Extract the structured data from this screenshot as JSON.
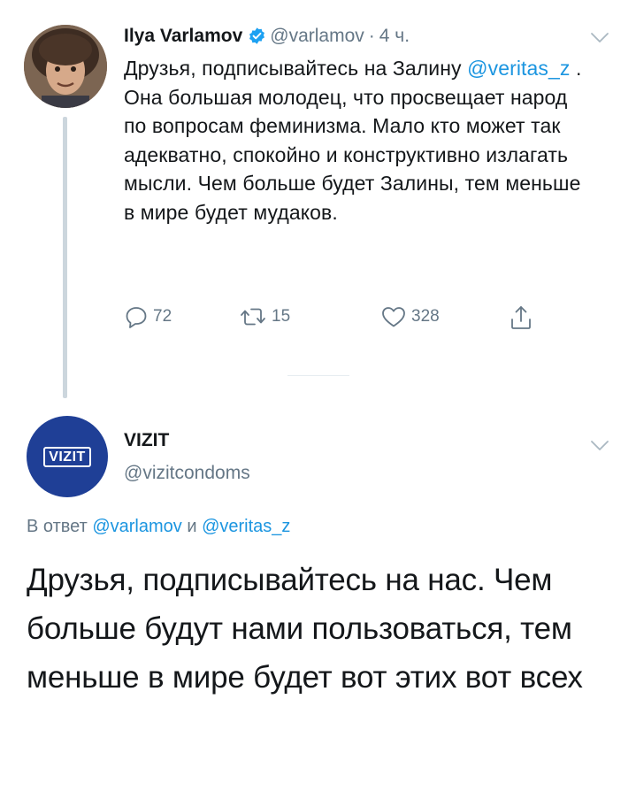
{
  "tweet1": {
    "author_name": "Ilya Varlamov",
    "author_handle": "@varlamov",
    "separator": "·",
    "time": "4 ч.",
    "text_before": "Друзья, подписывайтесь на Залину ",
    "mention": "@veritas_z",
    "text_after": " . Она большая молодец, что просвещает народ по вопросам феминизма. Мало кто может так адекватно, спокойно и конструктивно излагать мысли. Чем больше будет Залины, тем меньше в мире будет мудаков.",
    "reply_count": "72",
    "retweet_count": "15",
    "like_count": "328"
  },
  "tweet2": {
    "author_name": "VIZIT",
    "author_handle": "@vizitcondoms",
    "avatar_logo_text": "VIZIT",
    "reply_prefix": "В ответ ",
    "reply_user1": "@varlamov",
    "reply_joiner": " и ",
    "reply_user2": "@veritas_z",
    "text": "Друзья, подписывайтесь на нас. Чем больше будут нами пользоваться, тем меньше в мире будет вот этих вот всех"
  },
  "icons": {
    "verified": "verified-badge-icon",
    "caret": "chevron-down-icon",
    "reply": "reply-icon",
    "retweet": "retweet-icon",
    "like": "heart-icon",
    "share": "share-icon"
  },
  "colors": {
    "link": "#1b95e0",
    "secondary_text": "#657786",
    "thread_line": "#ccd6dd",
    "vizit_blue": "#1f3f96"
  }
}
